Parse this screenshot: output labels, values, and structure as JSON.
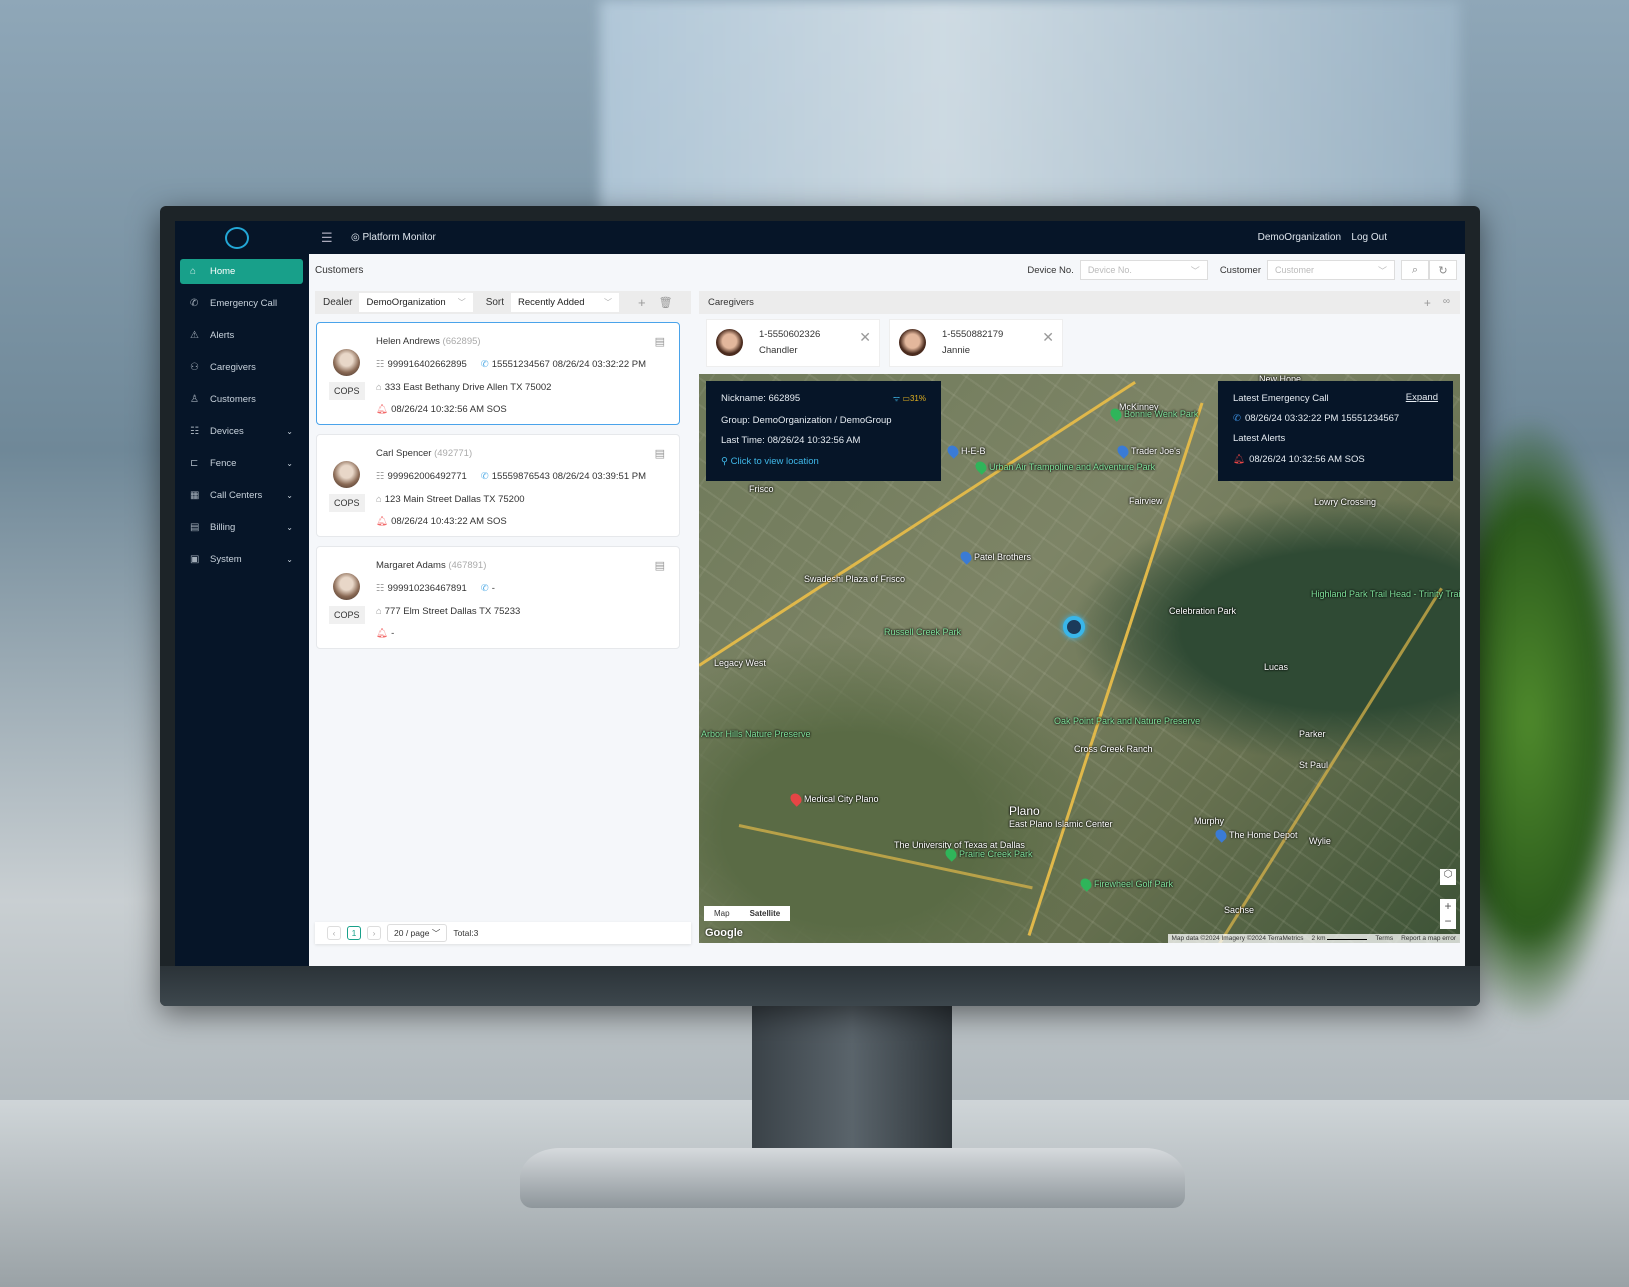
{
  "topbar": {
    "menu_icon": "hamburger-icon",
    "title": "Platform Monitor",
    "organization": "DemoOrganization",
    "logout": "Log Out"
  },
  "sidebar": {
    "items": [
      {
        "label": "Home",
        "icon": "home-icon",
        "active": true
      },
      {
        "label": "Emergency Call",
        "icon": "phone-icon"
      },
      {
        "label": "Alerts",
        "icon": "alert-icon"
      },
      {
        "label": "Caregivers",
        "icon": "users-icon"
      },
      {
        "label": "Customers",
        "icon": "customer-icon"
      },
      {
        "label": "Devices",
        "icon": "devices-icon",
        "expandable": true
      },
      {
        "label": "Fence",
        "icon": "fence-icon",
        "expandable": true
      },
      {
        "label": "Call Centers",
        "icon": "grid-icon",
        "expandable": true
      },
      {
        "label": "Billing",
        "icon": "billing-icon",
        "expandable": true
      },
      {
        "label": "System",
        "icon": "system-icon",
        "expandable": true
      }
    ]
  },
  "customers": {
    "title": "Customers",
    "dealer_label": "Dealer",
    "dealer_value": "DemoOrganization",
    "sort_label": "Sort",
    "sort_value": "Recently Added",
    "list": [
      {
        "name": "Helen Andrews",
        "id": "(662895)",
        "badge": "COPS",
        "device": "999916402662895",
        "call": "15551234567 08/26/24 03:32:22 PM",
        "address": "333 East Bethany Drive Allen TX 75002",
        "alert": "08/26/24 10:32:56 AM SOS",
        "selected": true
      },
      {
        "name": "Carl Spencer",
        "id": "(492771)",
        "badge": "COPS",
        "device": "999962006492771",
        "call": "15559876543 08/26/24 03:39:51 PM",
        "address": "123 Main Street Dallas TX 75200",
        "alert": "08/26/24 10:43:22 AM SOS"
      },
      {
        "name": "Margaret Adams",
        "id": "(467891)",
        "badge": "COPS",
        "device": "999910236467891",
        "call": "-",
        "address": "777 Elm Street Dallas TX 75233",
        "alert": "-"
      }
    ],
    "pagination": {
      "current": "1",
      "page_size": "20 / page",
      "total": "Total:3"
    }
  },
  "search": {
    "device_label": "Device No.",
    "device_placeholder": "Device No.",
    "customer_label": "Customer",
    "customer_placeholder": "Customer"
  },
  "caregivers": {
    "title": "Caregivers",
    "list": [
      {
        "phone": "1-5550602326",
        "name": "Chandler"
      },
      {
        "phone": "1-5550882179",
        "name": "Jannie"
      }
    ]
  },
  "map": {
    "info": {
      "nickname": "Nickname: 662895",
      "battery": "31%",
      "group": "Group: DemoOrganization / DemoGroup",
      "last_time": "Last Time: 08/26/24 10:32:56 AM",
      "view_location": "Click to view location"
    },
    "latest": {
      "title": "Latest Emergency Call",
      "expand": "Expand",
      "call": "08/26/24 03:32:22 PM 15551234567",
      "alerts_title": "Latest Alerts",
      "alert": "08/26/24 10:32:56 AM SOS"
    },
    "type_map": "Map",
    "type_satellite": "Satellite",
    "selected_type": "Satellite",
    "google": "Google",
    "attribution": "Map data ©2024 Imagery ©2024 TerraMetrics",
    "scale": "2 km",
    "terms": "Terms",
    "report": "Report a map error",
    "labels": [
      "McKinney",
      "Bonnie Wenk Park",
      "H-E-B",
      "Trader Joe's",
      "Urban Air Trampoline and Adventure Park",
      "Fairview",
      "Lowry Crossing",
      "Frisco",
      "Patel Brothers",
      "Swadeshi Plaza of Frisco",
      "Celebration Park",
      "Highland Park Trail Head - Trinity Trail",
      "Legacy West",
      "Russell Creek Park",
      "Lucas",
      "Oak Point Park and Nature Preserve",
      "Cross Creek Ranch",
      "Parker",
      "St Paul",
      "Plano",
      "Medical City Plano",
      "East Plano Islamic Center",
      "Murphy",
      "The Home Depot",
      "Wylie",
      "The University of Texas at Dallas",
      "Prairie Creek Park",
      "Firewheel Golf Park",
      "Sachse",
      "Arbor Hills Nature Preserve",
      "New Hope"
    ]
  },
  "colors": {
    "accent": "#18a08a",
    "nav_bg": "#061528",
    "selected_border": "#4aa3ea",
    "link": "#3fb7e8",
    "alert": "#e64545"
  }
}
